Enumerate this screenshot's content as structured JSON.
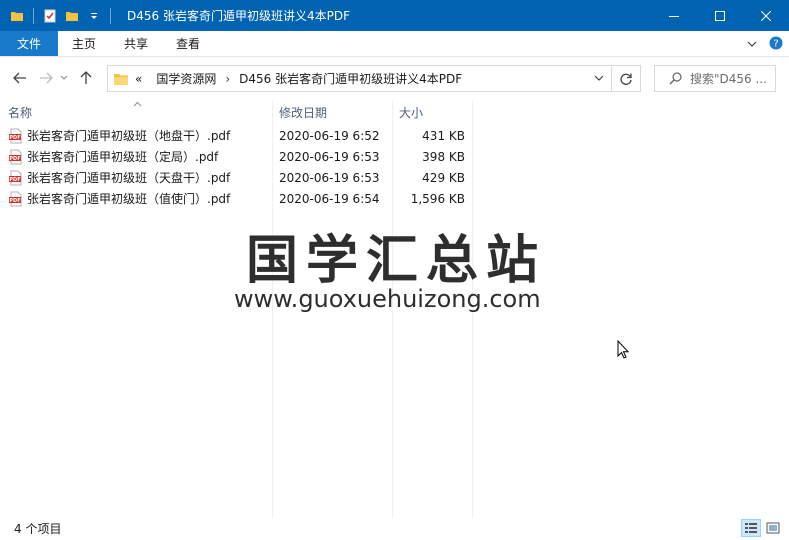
{
  "window": {
    "title": "D456 张岩客奇门遁甲初级班讲义4本PDF"
  },
  "ribbon": {
    "tabs": [
      "文件",
      "主页",
      "共享",
      "查看"
    ]
  },
  "address": {
    "overflow": "«",
    "crumbs": [
      "国学资源网",
      "D456 张岩客奇门遁甲初级班讲义4本PDF"
    ],
    "search_placeholder": "搜索\"D456 ..."
  },
  "columns": {
    "name": "名称",
    "date": "修改日期",
    "size": "大小"
  },
  "files": [
    {
      "name": "张岩客奇门遁甲初级班（地盘干）.pdf",
      "date": "2020-06-19 6:52",
      "size": "431 KB"
    },
    {
      "name": "张岩客奇门遁甲初级班（定局）.pdf",
      "date": "2020-06-19 6:53",
      "size": "398 KB"
    },
    {
      "name": "张岩客奇门遁甲初级班（天盘干）.pdf",
      "date": "2020-06-19 6:53",
      "size": "429 KB"
    },
    {
      "name": "张岩客奇门遁甲初级班（值使门）.pdf",
      "date": "2020-06-19 6:54",
      "size": "1,596 KB"
    }
  ],
  "watermark": {
    "chinese": "国学汇总站",
    "url": "www.guoxuehuizong.com"
  },
  "status": {
    "count": "4 个项目"
  },
  "colors": {
    "titlebar": "#0063b1",
    "file_tab": "#1979ca",
    "folder": "#f3c33f",
    "pdf_red": "#d32f2f"
  }
}
